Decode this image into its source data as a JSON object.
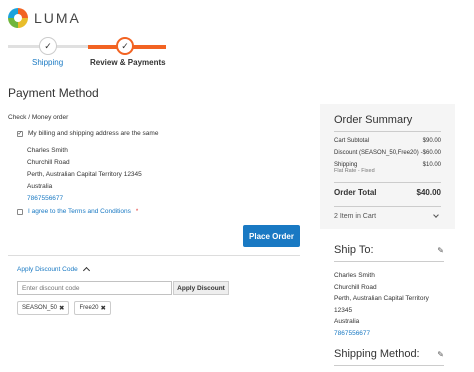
{
  "brand": {
    "name": "LUMA"
  },
  "progress": {
    "steps": [
      {
        "label": "Shipping",
        "state": "complete"
      },
      {
        "label": "Review & Payments",
        "state": "active"
      }
    ],
    "check_glyph": "✓",
    "accent": "#f26322"
  },
  "payment": {
    "title": "Payment Method",
    "method": "Check / Money order",
    "same_address_label": "My billing and shipping address are the same",
    "same_address_checked": true,
    "address": {
      "name": "Charles Smith",
      "street": "Churchill Road",
      "city_line": "Perth, Australian Capital Territory 12345",
      "country": "Australia",
      "phone": "7867556677"
    },
    "terms_label": "I agree to the Terms and Conditions",
    "terms_required_mark": "*",
    "place_order_label": "Place Order"
  },
  "discount": {
    "toggle_label": "Apply Discount Code",
    "placeholder": "Enter discount code",
    "apply_label": "Apply Discount",
    "applied": [
      "SEASON_50",
      "Free20"
    ],
    "remove_glyph": "✖"
  },
  "summary": {
    "title": "Order Summary",
    "subtotal_label": "Cart Subtotal",
    "subtotal_value": "$90.00",
    "discount_label": "Discount (SEASON_50,Free20)",
    "discount_value": "-$60.00",
    "shipping_label": "Shipping",
    "shipping_sub": "Flat Rate - Fixed",
    "shipping_value": "$10.00",
    "total_label": "Order Total",
    "total_value": "$40.00",
    "items_label": "2 Item in Cart"
  },
  "ship_to": {
    "title": "Ship To:",
    "name": "Charles Smith",
    "street": "Churchill Road",
    "city_line": "Perth, Australian Capital Territory",
    "zip": "12345",
    "country": "Australia",
    "phone": "7867556677"
  },
  "shipping_method": {
    "title": "Shipping Method:"
  },
  "colors": {
    "link": "#1979c3",
    "primary_button": "#1979c3",
    "accent": "#f26322",
    "summary_bg": "#f5f5f5"
  }
}
